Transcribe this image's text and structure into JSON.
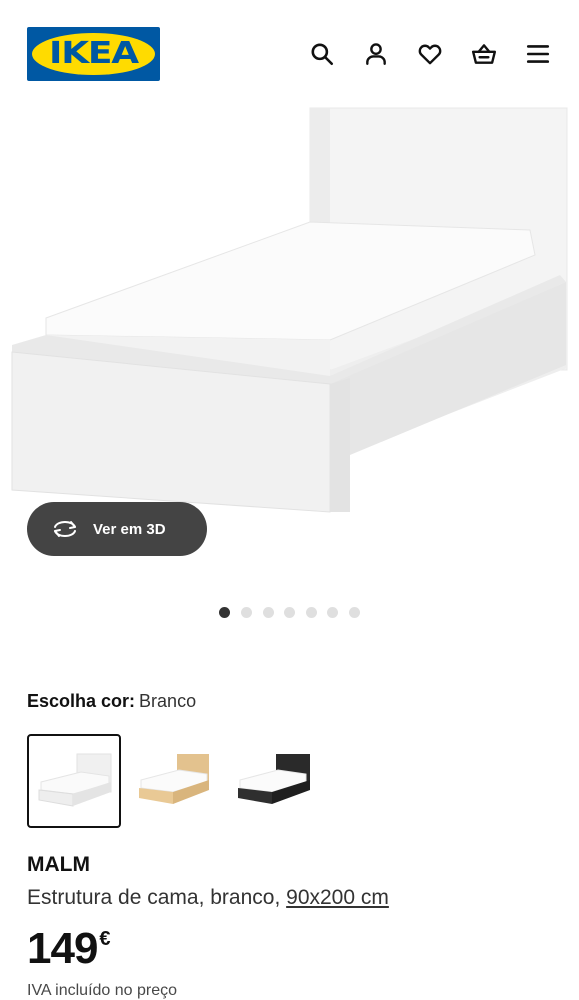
{
  "brand": {
    "logo_text": "IKEA",
    "blue": "#0058a3",
    "yellow": "#ffdb00"
  },
  "header": {
    "icons": [
      "search-icon",
      "user-icon",
      "heart-icon",
      "basket-icon",
      "menu-icon"
    ]
  },
  "gallery": {
    "view3d_label": "Ver em 3D",
    "slide_count": 7,
    "active_slide": 1
  },
  "color_picker": {
    "label": "Escolha cor:",
    "selected": "Branco",
    "options": [
      "white",
      "oak-veneer",
      "black-brown"
    ]
  },
  "product": {
    "name": "MALM",
    "description": "Estrutura de cama, branco, ",
    "size": "90x200 cm",
    "price": "149",
    "currency": "€",
    "vat_note": "IVA incluído no preço"
  }
}
